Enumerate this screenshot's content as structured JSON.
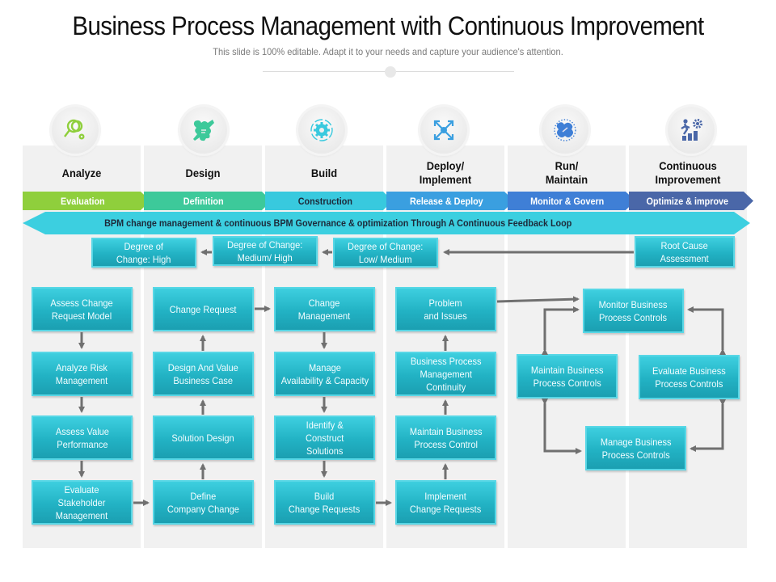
{
  "header": {
    "title": "Business Process Management with Continuous Improvement",
    "subtitle": "This slide is 100% editable. Adapt it to your needs and capture your audience's attention."
  },
  "phases": [
    {
      "label": "Analyze",
      "stage": "Evaluation",
      "icon": "magnifier-gear-icon",
      "color": "#8fcf3c"
    },
    {
      "label": "Design",
      "stage": "Definition",
      "icon": "puzzle-pencil-icon",
      "color": "#3dc99a"
    },
    {
      "label": "Build",
      "stage": "Construction",
      "icon": "gear-cycle-icon",
      "color": "#38c9de"
    },
    {
      "label": "Deploy/\nImplement",
      "stage": "Release & Deploy",
      "icon": "expand-arrows-icon",
      "color": "#3a9fe0"
    },
    {
      "label": "Run/\nMaintain",
      "stage": "Monitor & Govern",
      "icon": "puzzle-piece-icon",
      "color": "#3f7fd6"
    },
    {
      "label": "Continuous\nImprovement",
      "stage": "Optimize & improve",
      "icon": "growth-person-icon",
      "color": "#4a67a8"
    }
  ],
  "feedback_loop": "BPM change management & continuous BPM Governance & optimization Through A Continuous Feedback Loop",
  "degree_boxes": [
    "Degree of\nChange: High",
    "Degree of Change:\nMedium/ High",
    "Degree of Change:\nLow/ Medium",
    "Root Cause\nAssessment"
  ],
  "analyze_boxes": [
    "Assess Change\nRequest Model",
    "Analyze Risk\nManagement",
    "Assess Value\nPerformance",
    "Evaluate\nStakeholder\nManagement"
  ],
  "design_boxes": [
    "Change Request",
    "Design And Value\nBusiness Case",
    "Solution Design",
    "Define\nCompany Change"
  ],
  "build_boxes": [
    "Change\nManagement",
    "Manage\nAvailability & Capacity",
    "Identify &\nConstruct\nSolutions",
    "Build\nChange Requests"
  ],
  "deploy_boxes": [
    "Problem\nand Issues",
    "Business Process\nManagement\nContinuity",
    "Maintain Business\nProcess Control",
    "Implement\nChange Requests"
  ],
  "cycle_boxes": {
    "monitor": "Monitor Business\nProcess Controls",
    "maintain": "Maintain Business\nProcess Controls",
    "evaluate": "Evaluate Business\nProcess Controls",
    "manage": "Manage Business\nProcess Controls"
  }
}
